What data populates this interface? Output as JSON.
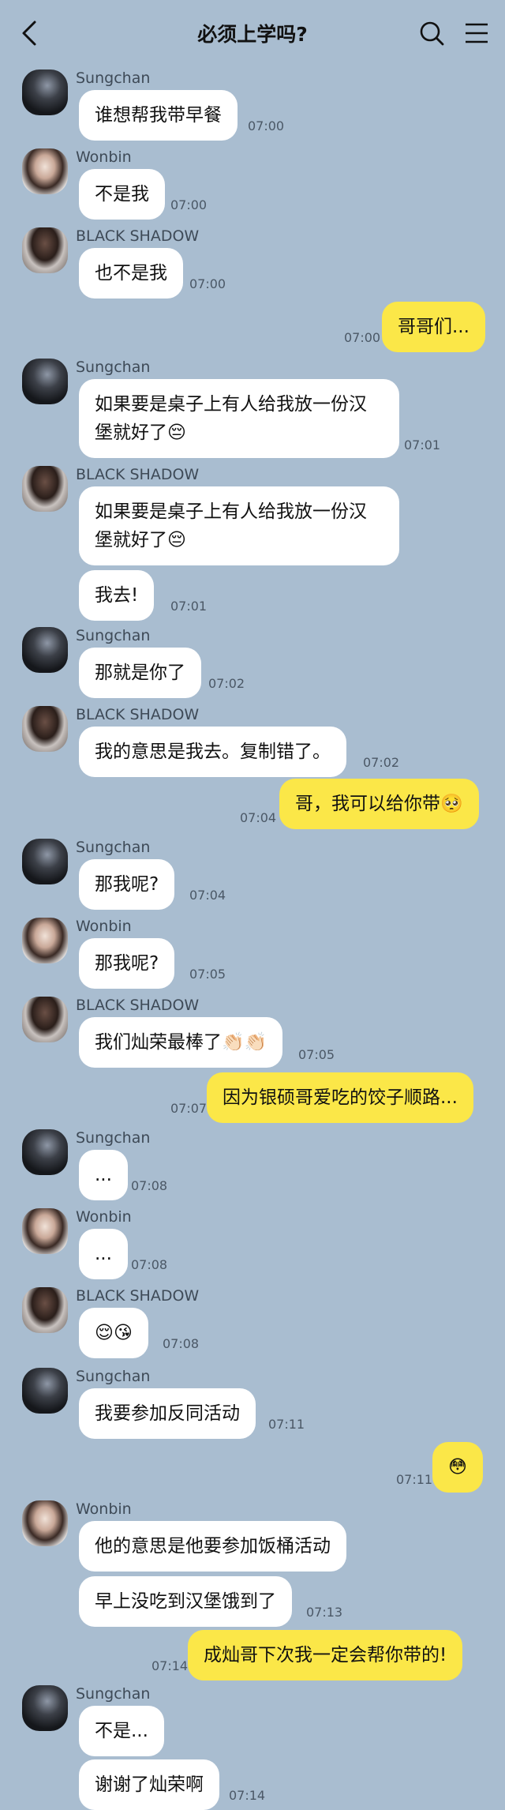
{
  "header": {
    "title": "必须上学吗?"
  },
  "messages": [
    {
      "sender": "Sungchan",
      "text": "谁想帮我带早餐",
      "time": "07:00"
    },
    {
      "sender": "Wonbin",
      "text": "不是我",
      "time": "07:00"
    },
    {
      "sender": "BLACK SHADOW",
      "text": "也不是我",
      "time": "07:00"
    },
    {
      "sender": "me",
      "text": "哥哥们...",
      "time": "07:00"
    },
    {
      "sender": "Sungchan",
      "text": "如果要是桌子上有人给我放一份汉堡就好了😔",
      "time": "07:01"
    },
    {
      "sender": "BLACK SHADOW",
      "text": "如果要是桌子上有人给我放一份汉堡就好了😔",
      "time": ""
    },
    {
      "sender": "BLACK SHADOW",
      "text": "我去!",
      "time": "07:01"
    },
    {
      "sender": "Sungchan",
      "text": "那就是你了",
      "time": "07:02"
    },
    {
      "sender": "BLACK SHADOW",
      "text": "我的意思是我去。复制错了。",
      "time": "07:02"
    },
    {
      "sender": "me",
      "text": "哥，我可以给你带🥺",
      "time": "07:04"
    },
    {
      "sender": "Sungchan",
      "text": "那我呢?",
      "time": "07:04"
    },
    {
      "sender": "Wonbin",
      "text": "那我呢?",
      "time": "07:05"
    },
    {
      "sender": "BLACK SHADOW",
      "text": "我们灿荣最棒了👏🏻👏🏻",
      "time": "07:05"
    },
    {
      "sender": "me",
      "text": "因为银硕哥爱吃的饺子顺路...",
      "time": "07:07"
    },
    {
      "sender": "Sungchan",
      "text": "...",
      "time": "07:08"
    },
    {
      "sender": "Wonbin",
      "text": "...",
      "time": "07:08"
    },
    {
      "sender": "BLACK SHADOW",
      "text": "😌😘",
      "time": "07:08"
    },
    {
      "sender": "Sungchan",
      "text": "我要参加反同活动",
      "time": "07:11"
    },
    {
      "sender": "me",
      "text": "😳",
      "time": "07:11"
    },
    {
      "sender": "Wonbin",
      "text": "他的意思是他要参加饭桶活动",
      "time": ""
    },
    {
      "sender": "Wonbin",
      "text": "早上没吃到汉堡饿到了",
      "time": "07:13"
    },
    {
      "sender": "me",
      "text": "成灿哥下次我一定会帮你带的!",
      "time": "07:14"
    },
    {
      "sender": "Sungchan",
      "text": "不是...",
      "time": ""
    },
    {
      "sender": "Sungchan",
      "text": "谢谢了灿荣啊",
      "time": "07:14"
    }
  ],
  "names": {
    "sungchan": "Sungchan",
    "wonbin": "Wonbin",
    "black": "BLACK SHADOW"
  },
  "colors": {
    "background": "#a9bdd0",
    "my_bubble": "#fbe748",
    "other_bubble": "#ffffff"
  },
  "icons": {
    "back": "chevron-left-icon",
    "search": "search-icon",
    "menu": "menu-icon"
  }
}
